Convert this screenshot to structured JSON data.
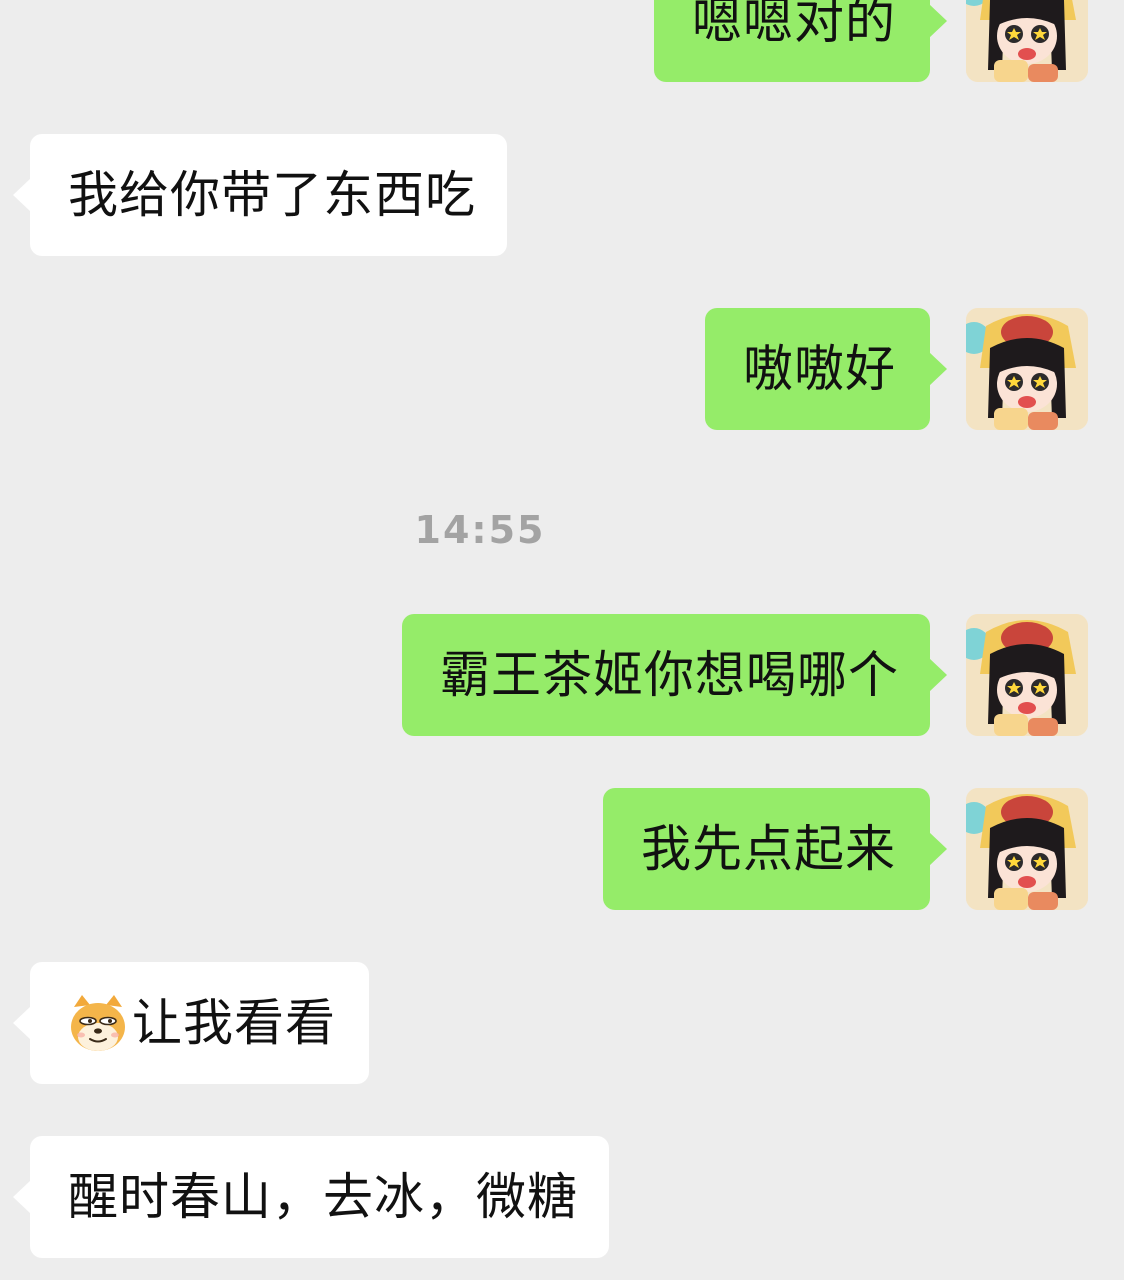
{
  "messages": [
    {
      "id": "m1",
      "side": "out",
      "text": "嗯嗯对的"
    },
    {
      "id": "m2",
      "side": "in",
      "text": "我给你带了东西吃"
    },
    {
      "id": "m3",
      "side": "out",
      "text": "嗷嗷好"
    },
    {
      "id": "m4",
      "side": "out",
      "text": "霸王茶姬你想喝哪个"
    },
    {
      "id": "m5",
      "side": "out",
      "text": "我先点起来"
    },
    {
      "id": "m6",
      "side": "in",
      "emoji": "doge-emoji-icon",
      "text": "让我看看"
    },
    {
      "id": "m7",
      "side": "in",
      "text": "醒时春山，去冰，微糖"
    }
  ],
  "timestamp": "14:55",
  "colors": {
    "background": "#ededed",
    "outgoing_bubble": "#95ec69",
    "incoming_bubble": "#ffffff",
    "timestamp_text": "#a3a3a3",
    "message_text": "#111111"
  },
  "avatar": {
    "icon": "anime-girl-avatar-icon"
  }
}
